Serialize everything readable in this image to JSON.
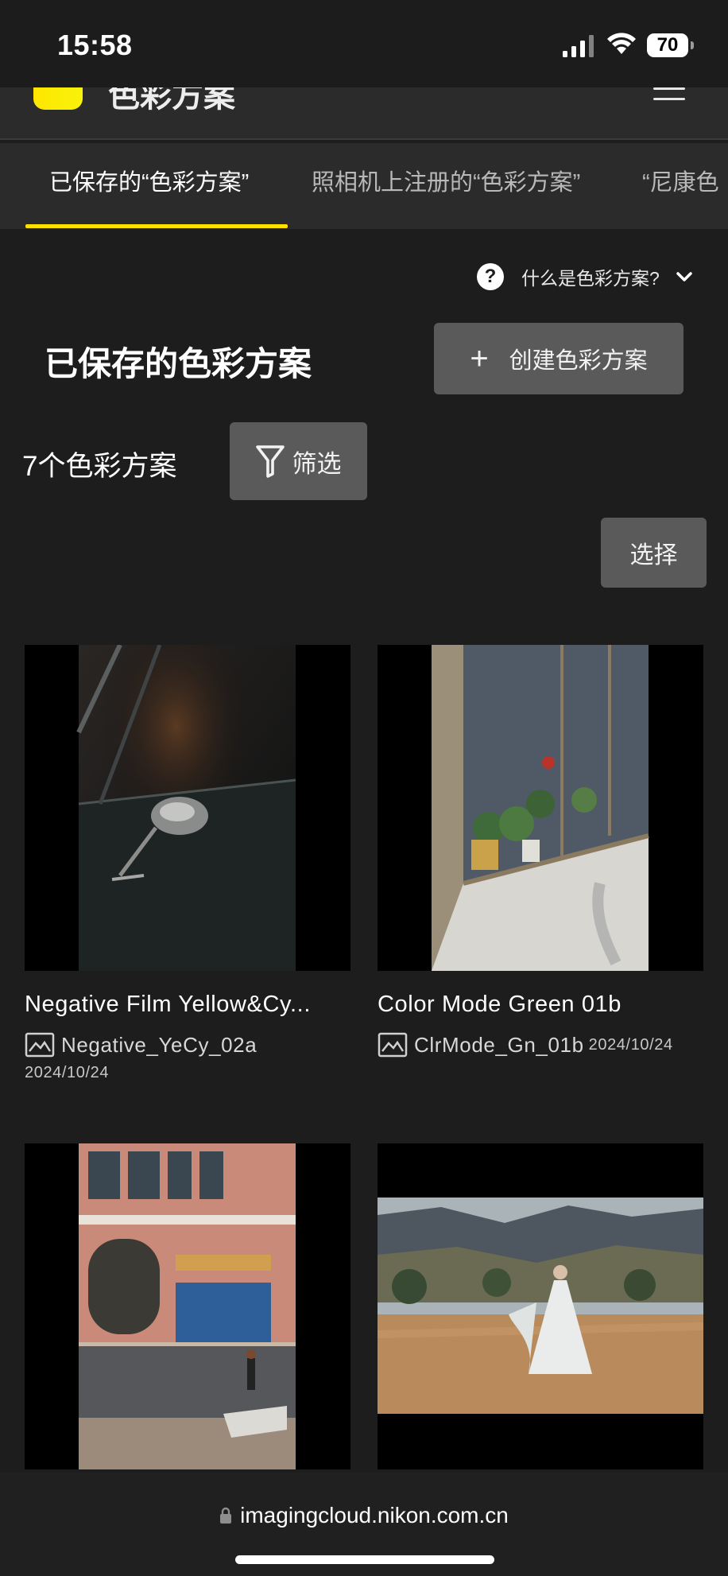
{
  "status_bar": {
    "time": "15:58",
    "battery": "70"
  },
  "header": {
    "title": "色彩方案"
  },
  "tabs": [
    {
      "label": "已保存的“色彩方案”"
    },
    {
      "label": "照相机上注册的“色彩方案”"
    },
    {
      "label": "“尼康色"
    }
  ],
  "help": {
    "icon": "?",
    "label": "什么是色彩方案?"
  },
  "main": {
    "title": "已保存的色彩方案",
    "create_label": "创建色彩方案",
    "count": "7个色彩方案",
    "filter_label": "筛选",
    "select_label": "选择"
  },
  "recipes": [
    {
      "title": "Negative Film Yellow&Cy...",
      "code": "Negative_YeCy_02a",
      "date": "2024/10/24"
    },
    {
      "title": "Color Mode Green 01b",
      "code": "ClrMode_Gn_01b",
      "date": "2024/10/24"
    }
  ],
  "browser": {
    "url": "imagingcloud.nikon.com.cn"
  },
  "colors": {
    "accent": "#ffe100",
    "background": "#1d1d1e",
    "button": "#5a5a5b"
  }
}
